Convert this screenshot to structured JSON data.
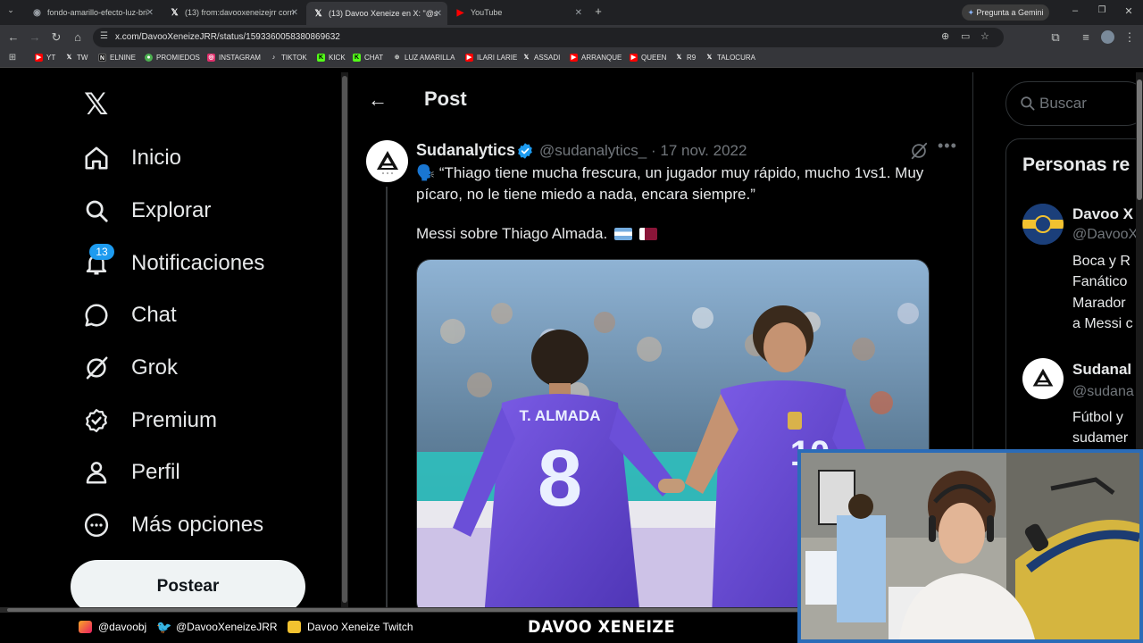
{
  "browser": {
    "tabs": [
      {
        "title": "fondo-amarillo-efecto-luz-brilla",
        "icon": "doc-icon"
      },
      {
        "title": "(13) from:davooxeneizejrr corre",
        "icon": "x-icon"
      },
      {
        "title": "(13) Davoo Xeneize en X: \"@su",
        "icon": "x-icon"
      },
      {
        "title": "YouTube",
        "icon": "youtube-icon"
      }
    ],
    "url": "x.com/DavooXeneizeJRR/status/1593360058380869632",
    "gemini_label": "Pregunta a Gemini",
    "bookmarks": [
      "YT",
      "TW",
      "ELNINE",
      "PROMIEDOS",
      "INSTAGRAM",
      "TIKTOK",
      "KICK",
      "CHAT",
      "LUZ AMARILLA",
      "ILARI LARIE",
      "ASSADI",
      "ARRANQUE",
      "QUEEN",
      "R9",
      "TALOCURA"
    ]
  },
  "sidebar": {
    "items": [
      {
        "label": "Inicio",
        "icon": "home-icon"
      },
      {
        "label": "Explorar",
        "icon": "search-icon"
      },
      {
        "label": "Notificaciones",
        "icon": "bell-icon"
      },
      {
        "label": "Chat",
        "icon": "chat-icon"
      },
      {
        "label": "Grok",
        "icon": "grok-icon"
      },
      {
        "label": "Premium",
        "icon": "verified-badge-icon"
      },
      {
        "label": "Perfil",
        "icon": "person-icon"
      },
      {
        "label": "Más opciones",
        "icon": "more-circle-icon"
      }
    ],
    "notifications_count": "13",
    "post_button": "Postear"
  },
  "post": {
    "header_title": "Post",
    "author_name": "Sudanalytics",
    "author_handle": "@sudanalytics_",
    "date": "17 nov. 2022",
    "text": "🗣️ “Thiago tiene mucha frescura, un jugador muy rápido, mucho 1vs1. Muy pícaro, no le tiene miedo a nada, encara siempre.”",
    "subtext": "Messi sobre Thiago Almada.",
    "jersey_name": "T. ALMADA",
    "jersey_number": "8",
    "jersey_number_2": "10"
  },
  "right": {
    "search_placeholder": "Buscar",
    "related_title": "Personas re",
    "people": [
      {
        "name": "Davoo X",
        "handle": "@DavooX",
        "bio": [
          "Boca y R",
          "Fanático",
          "Marador",
          "a Messi c"
        ]
      },
      {
        "name": "Sudanal",
        "handle": "@sudana",
        "bio": [
          "Fútbol y",
          "sudamer"
        ]
      }
    ]
  },
  "overlay": {
    "instagram": "@davoobj",
    "twitter": "@DavooXeneizeJRR",
    "twitch": "Davoo Xeneize Twitch",
    "brand": "DAVOO XENEIZE"
  },
  "colors": {
    "accent": "#1d9bf0",
    "background": "#000000",
    "text": "#e7e9ea",
    "muted": "#71767b",
    "jersey": "#6b4fd8"
  }
}
